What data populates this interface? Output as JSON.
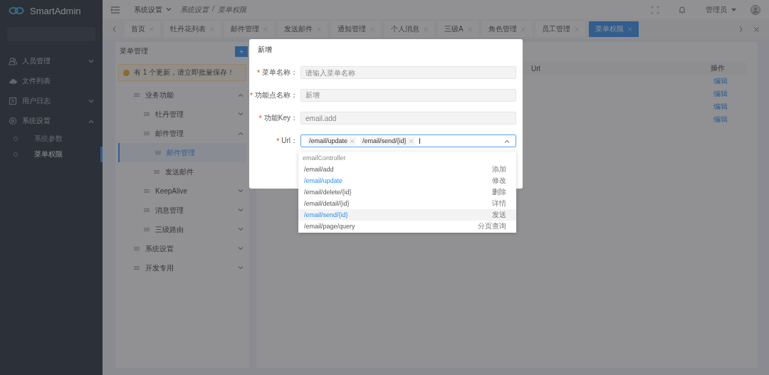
{
  "app": {
    "logo_text": "SmartAdmin"
  },
  "sidebar": {
    "items": [
      {
        "label": "人员管理",
        "expanded": false
      },
      {
        "label": "文件列表"
      },
      {
        "label": "用户日志",
        "expanded": false
      },
      {
        "label": "系统设置",
        "expanded": true,
        "children": [
          {
            "label": "系统参数",
            "selected": false
          },
          {
            "label": "菜单权限",
            "selected": true
          }
        ]
      }
    ]
  },
  "header": {
    "menu_title": "系统设置",
    "breadcrumb": [
      "系统设置",
      "菜单权限"
    ],
    "breadcrumb_separator": "/",
    "user": "管理员"
  },
  "tabs": [
    {
      "label": "首页",
      "selected": false
    },
    {
      "label": "牡丹花列表",
      "selected": false
    },
    {
      "label": "邮件管理",
      "selected": false
    },
    {
      "label": "发送邮件",
      "selected": false
    },
    {
      "label": "通知管理",
      "selected": false
    },
    {
      "label": "个人消息",
      "selected": false
    },
    {
      "label": "三级A",
      "selected": false
    },
    {
      "label": "角色管理",
      "selected": false
    },
    {
      "label": "员工管理",
      "selected": false
    },
    {
      "label": "菜单权限",
      "selected": true
    }
  ],
  "menu_panel": {
    "title": "菜单管理",
    "add_button": "+",
    "alert": "有 1 个更新，请立即批量保存！",
    "tree": [
      {
        "label": "业务功能",
        "expanded": true,
        "selected": false,
        "children": [
          {
            "label": "牡丹管理",
            "expanded": false,
            "selected": false
          },
          {
            "label": "邮件管理",
            "expanded": true,
            "selected": false,
            "children": [
              {
                "label": "邮件管理",
                "selected": true
              },
              {
                "label": "发送邮件",
                "selected": false
              }
            ]
          },
          {
            "label": "KeepAlive",
            "expanded": false,
            "selected": false
          },
          {
            "label": "消息管理",
            "expanded": false,
            "selected": false
          },
          {
            "label": "三级路由",
            "expanded": false,
            "selected": false
          }
        ]
      },
      {
        "label": "系统设置",
        "expanded": false,
        "selected": false
      },
      {
        "label": "开发专用",
        "expanded": false,
        "selected": false
      }
    ]
  },
  "table": {
    "columns": [
      "Url",
      "操作"
    ],
    "rows": [
      {
        "action": "编辑"
      },
      {
        "action": "编辑"
      },
      {
        "action": "编辑"
      },
      {
        "action": "编辑"
      }
    ]
  },
  "modal": {
    "title": "新增",
    "fields": [
      {
        "required_mark": "*",
        "label": "菜单名称：",
        "placeholder": "请输入菜单名称",
        "disabled": true
      },
      {
        "required_mark": "*",
        "label": "功能点名称：",
        "value": "新增",
        "disabled": true
      },
      {
        "required_mark": "*",
        "label": "功能Key：",
        "value": "email.add",
        "disabled": true
      }
    ],
    "url_field": {
      "required_mark": "*",
      "label": "Url：",
      "tags": [
        "/email/update",
        "/email/send/{id}"
      ],
      "open": true
    },
    "dropdown": {
      "group": "emailController",
      "options": [
        {
          "path": "/email/add",
          "desc": "添加",
          "selected": false,
          "hovered": false
        },
        {
          "path": "/email/update",
          "desc": "修改",
          "selected": true,
          "hovered": false
        },
        {
          "path": "/email/delete/{id}",
          "desc": "删除",
          "selected": false,
          "hovered": false
        },
        {
          "path": "/email/detail/{id}",
          "desc": "详情",
          "selected": false,
          "hovered": false
        },
        {
          "path": "/email/send/{id}",
          "desc": "发送",
          "selected": true,
          "hovered": true
        },
        {
          "path": "/email/page/query",
          "desc": "分页查询",
          "selected": false,
          "hovered": false
        }
      ]
    }
  }
}
